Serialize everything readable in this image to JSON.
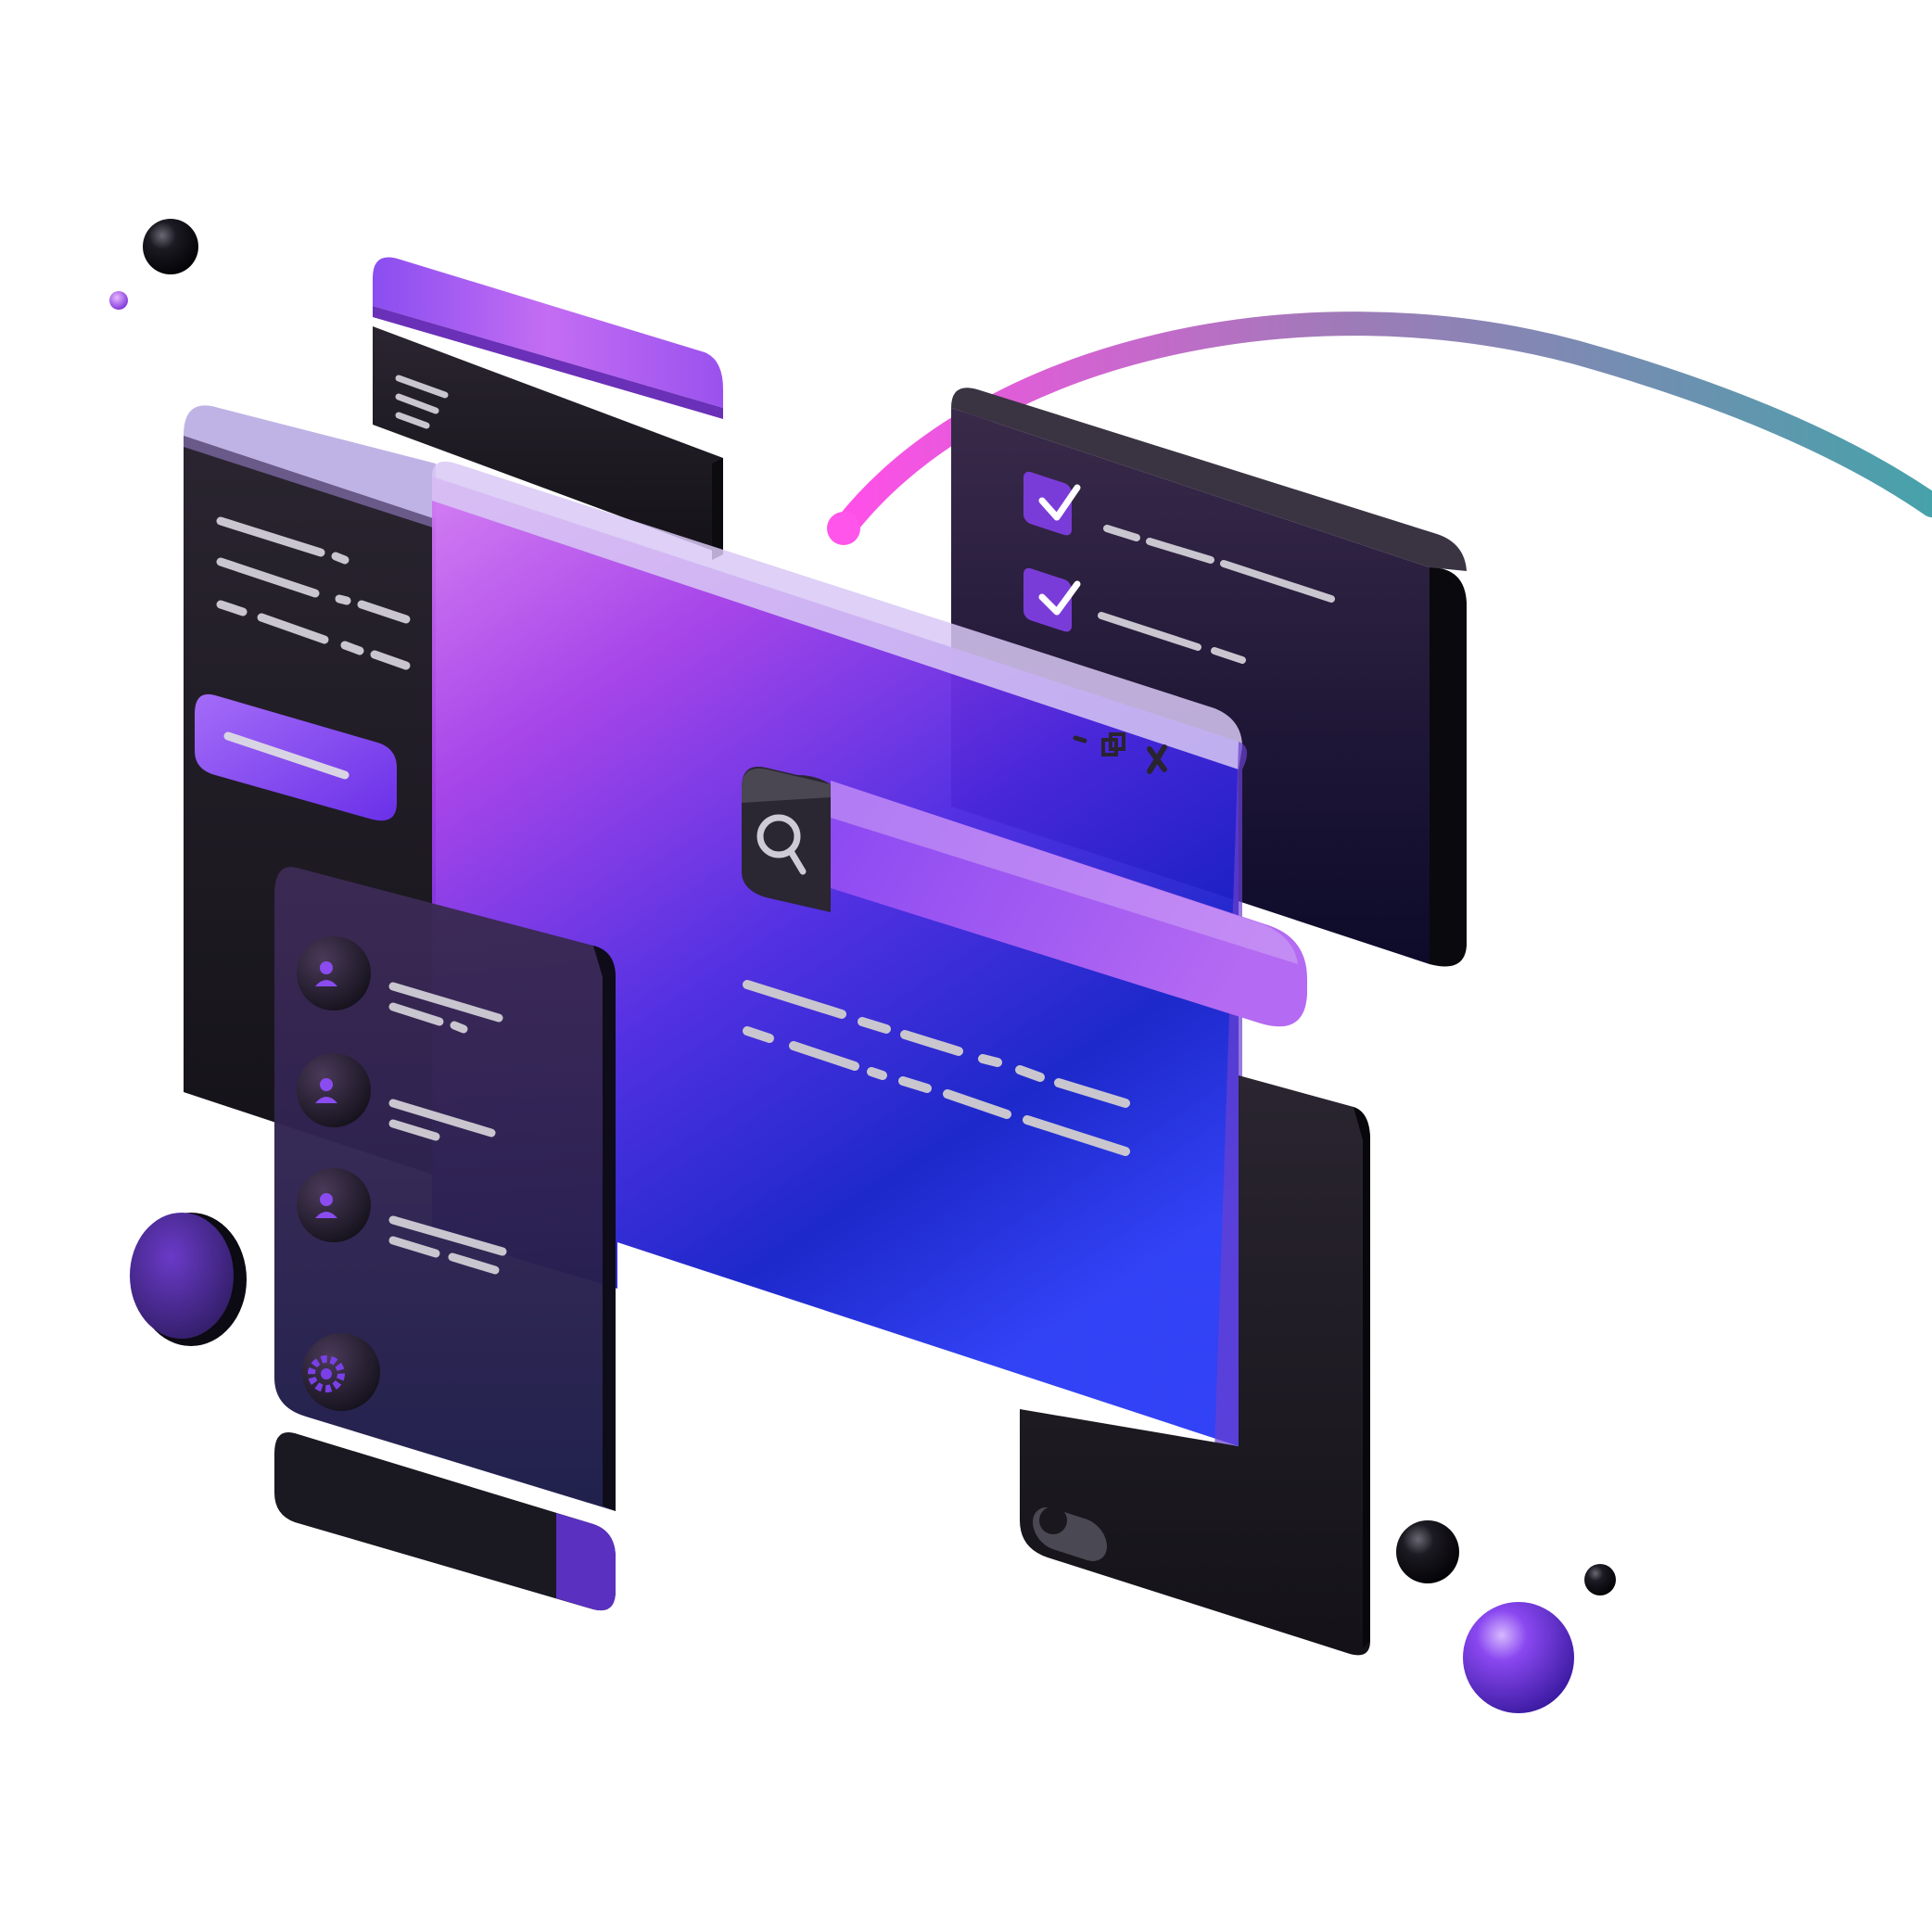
{
  "scene": {
    "description_free": true,
    "colors": {
      "background": "#ffffff",
      "panel_dark": "#1c1a20",
      "panel_dark_edge": "#0e0d12",
      "purple_light": "#c25cf0",
      "purple": "#8a3cf0",
      "violet": "#5a2cf0",
      "blue": "#1a2cf5",
      "deep_blue": "#0a14a8",
      "arc_start": "#ff4fe8",
      "arc_end": "#4aa0a8",
      "line_gray": "#c9c6cf"
    }
  },
  "icons": {
    "search": "search-icon",
    "check": "checkmark-icon",
    "user": "user-icon",
    "settings": "gear-icon",
    "minimize": "minimize-icon",
    "restore": "restore-icon",
    "close": "close-icon",
    "toggle": "toggle-switch"
  },
  "main_window": {
    "controls": [
      "minimize",
      "restore",
      "close"
    ]
  },
  "checklist_panel": {
    "items": [
      {
        "checked": true
      },
      {
        "checked": true
      }
    ]
  },
  "sidebar_panel": {
    "user_items": 3,
    "has_settings": true
  },
  "toggle": {
    "on": false
  }
}
